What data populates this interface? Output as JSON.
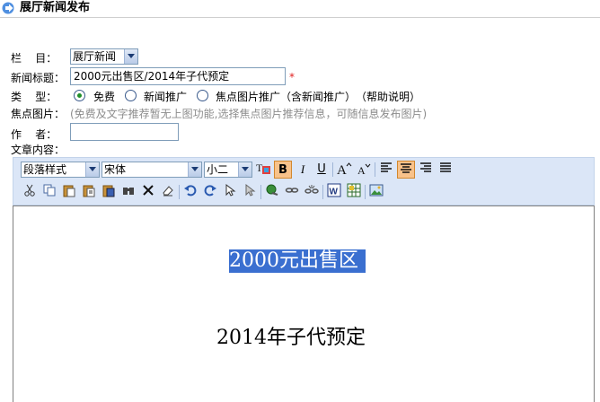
{
  "header": {
    "title": "展厅新闻发布"
  },
  "form": {
    "column_label": "栏    目：",
    "column_value": "展厅新闻",
    "news_title_label": "新闻标题：",
    "news_title_value": "2000元出售区/2014年子代预定",
    "required_mark": "*",
    "type_label": "类    型：",
    "type_options": [
      "免费",
      "新闻推广",
      "焦点图片推广（含新闻推广）"
    ],
    "help_link": "（帮助说明）",
    "focus_image_label": "焦点图片：",
    "focus_image_hint": "(免费及文字推荐暂无上图功能,选择焦点图片推荐信息，可随信息发布图片)",
    "author_label": "作    者：",
    "author_value": "",
    "content_label": "文章内容："
  },
  "toolbar": {
    "paragraph_style": "段落样式",
    "font_name": "宋体",
    "font_size": "小二",
    "bold": "B",
    "italic": "I",
    "underline": "U"
  },
  "editor": {
    "line1": "2000元出售区",
    "line2": "2014年子代预定",
    "selection_color": "#3a6fd0"
  }
}
